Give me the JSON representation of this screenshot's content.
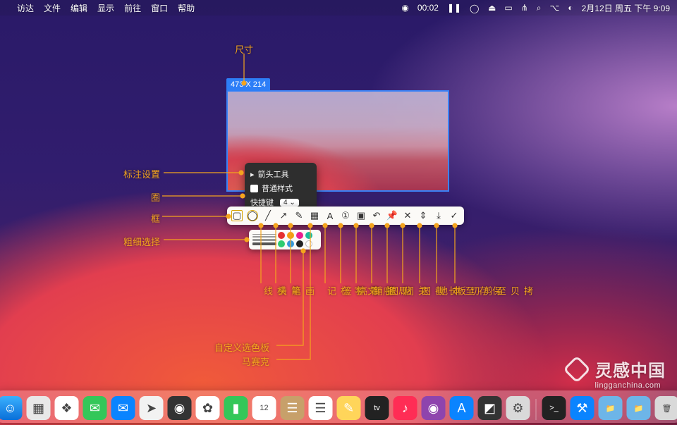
{
  "menubar": {
    "apple_icon": "apple-logo",
    "items": [
      "访达",
      "文件",
      "编辑",
      "显示",
      "前往",
      "窗口",
      "帮助"
    ],
    "status": {
      "rec_time": "00:02",
      "date": "2月12日 周五 下午 9:09"
    }
  },
  "selection": {
    "badge": "473 X 214"
  },
  "popover": {
    "title": "箭头工具",
    "style_label": "普通样式",
    "shortcut_label": "快捷键",
    "shortcut_key": "4"
  },
  "annotations": {
    "size": "尺寸",
    "mark_settings": "标注设置",
    "circle": "圈",
    "box": "框",
    "thickness": "粗细选择",
    "custom_palette": "自定义选色板",
    "mosaic": "马赛克"
  },
  "toolbar_items": [
    {
      "name": "tool-rect",
      "icon": "▢"
    },
    {
      "name": "tool-oval",
      "icon": "◯"
    },
    {
      "name": "tool-line",
      "icon": "╱"
    },
    {
      "name": "tool-arrow",
      "icon": "↗"
    },
    {
      "name": "tool-pen",
      "icon": "✎"
    },
    {
      "name": "tool-mosaic",
      "icon": "▦"
    },
    {
      "name": "tool-text",
      "icon": "A"
    },
    {
      "name": "tool-number",
      "icon": "①"
    },
    {
      "name": "tool-highlight",
      "icon": "▣"
    },
    {
      "name": "tool-undo",
      "icon": "↶"
    },
    {
      "name": "tool-pin",
      "icon": "📌"
    },
    {
      "name": "tool-close",
      "icon": "✕"
    },
    {
      "name": "tool-scrollshot",
      "icon": "⇕"
    },
    {
      "name": "tool-save",
      "icon": "⤓"
    },
    {
      "name": "tool-copy",
      "icon": "✓"
    }
  ],
  "tool_labels": [
    "横线",
    "箭头",
    "画笔",
    "文字标记",
    "序号标签",
    "局部高亮",
    "撤销",
    "贴图",
    "关闭",
    "长截图",
    "保存至本地",
    "拷贝至剪切板"
  ],
  "brush_colors": [
    "#e53131",
    "#f39c12",
    "#e91e8f",
    "#1abc9c",
    "#2ecc71",
    "#3498db",
    "#222",
    "#fff"
  ],
  "dock": [
    {
      "name": "finder",
      "bg": "linear-gradient(#3ab0ff,#0a6fd8)",
      "g": "☺"
    },
    {
      "name": "launchpad",
      "bg": "#e8e8e8",
      "g": "▦"
    },
    {
      "name": "safari",
      "bg": "#fff",
      "g": "❖"
    },
    {
      "name": "messages",
      "bg": "#34c759",
      "g": "✉"
    },
    {
      "name": "mail",
      "bg": "#0a84ff",
      "g": "✉"
    },
    {
      "name": "maps",
      "bg": "#f2f2f2",
      "g": "➤"
    },
    {
      "name": "camera",
      "bg": "#333",
      "g": "◉"
    },
    {
      "name": "photos",
      "bg": "#fff",
      "g": "✿"
    },
    {
      "name": "facetime",
      "bg": "#34c759",
      "g": "▮"
    },
    {
      "name": "calendar",
      "bg": "#fff",
      "g": "12"
    },
    {
      "name": "contacts",
      "bg": "#c7a06a",
      "g": "☰"
    },
    {
      "name": "reminders",
      "bg": "#fff",
      "g": "☰"
    },
    {
      "name": "notes",
      "bg": "#ffd55a",
      "g": "✎"
    },
    {
      "name": "tv",
      "bg": "#222",
      "g": "tv"
    },
    {
      "name": "music",
      "bg": "#ff2d55",
      "g": "♪"
    },
    {
      "name": "podcasts",
      "bg": "#8e44ad",
      "g": "◉"
    },
    {
      "name": "appstore",
      "bg": "#0a84ff",
      "g": "A"
    },
    {
      "name": "screenshot",
      "bg": "#333",
      "g": "◩"
    },
    {
      "name": "settings",
      "bg": "#d9d9d9",
      "g": "⚙"
    },
    {
      "name": "sep",
      "sep": true
    },
    {
      "name": "terminal",
      "bg": "#222",
      "g": ">_"
    },
    {
      "name": "xcode",
      "bg": "#0a84ff",
      "g": "⚒"
    },
    {
      "name": "folder1",
      "bg": "#6db5e8",
      "g": "📁"
    },
    {
      "name": "folder2",
      "bg": "#6db5e8",
      "g": "📁"
    },
    {
      "name": "bin",
      "bg": "#d9d9d9",
      "g": "🗑"
    }
  ],
  "watermark": {
    "title": "灵感中国",
    "sub": "lingganchina.com"
  }
}
